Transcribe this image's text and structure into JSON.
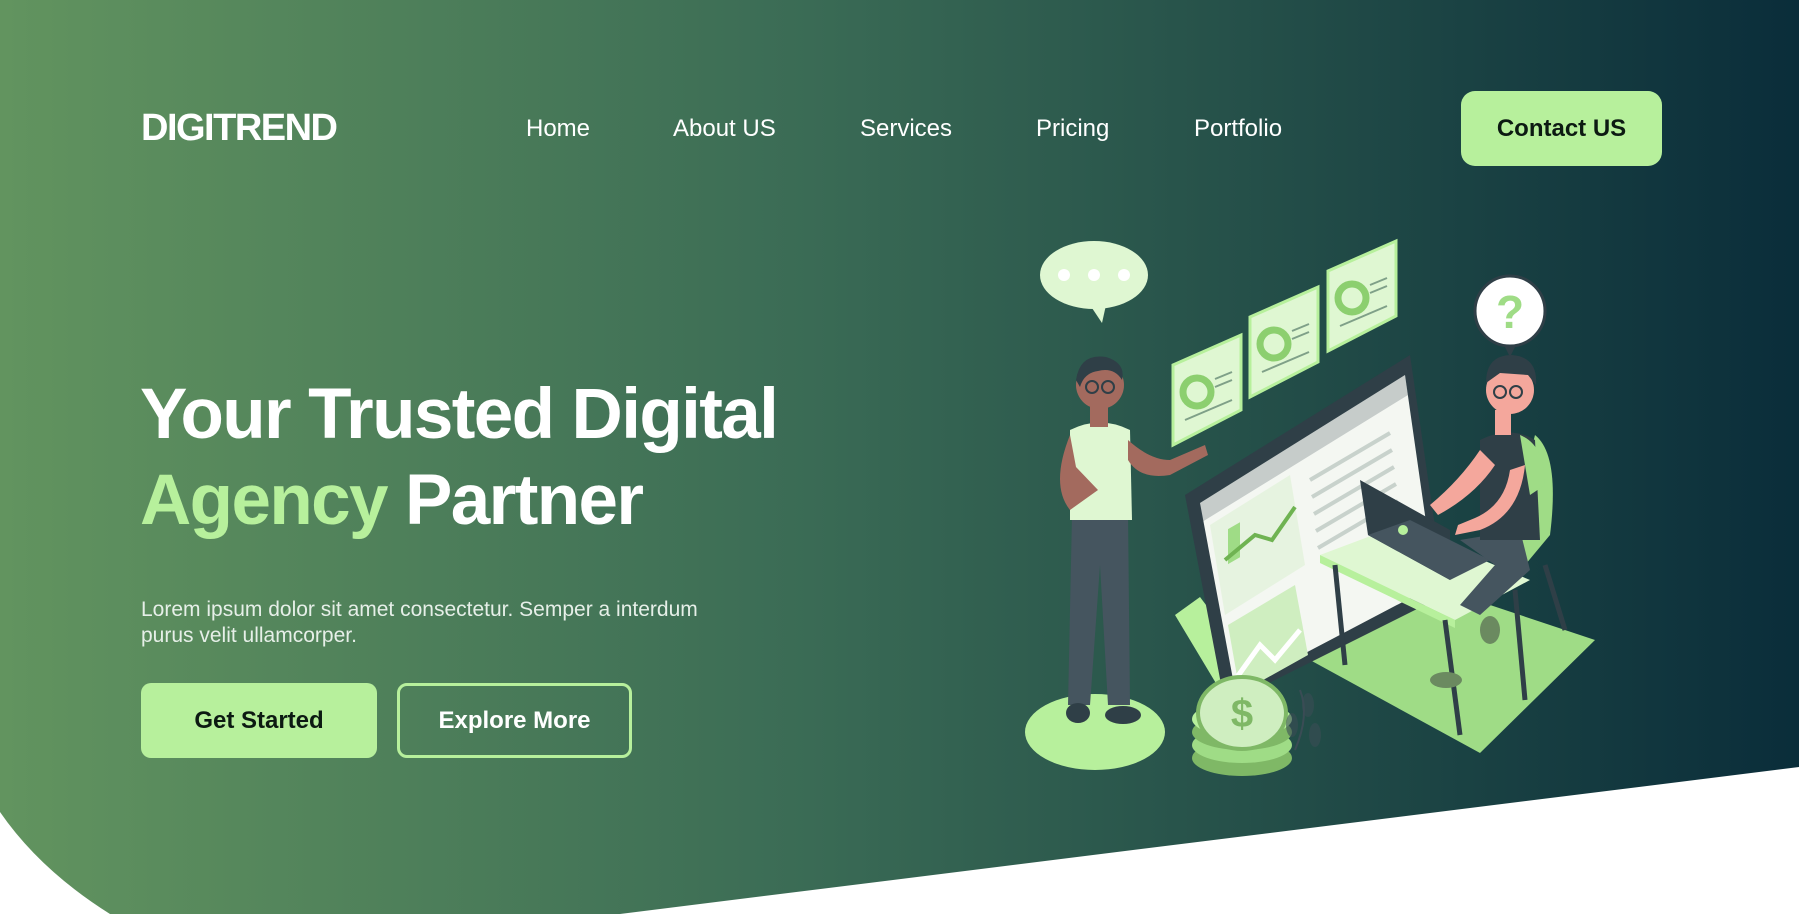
{
  "colors": {
    "gradient_start": "#62945f",
    "gradient_end": "#0a2d3a",
    "accent": "#b7f09c",
    "white": "#ffffff"
  },
  "header": {
    "logo": "DIGITREND",
    "nav": [
      {
        "label": "Home"
      },
      {
        "label": "About US"
      },
      {
        "label": "Services"
      },
      {
        "label": "Pricing"
      },
      {
        "label": "Portfolio"
      }
    ],
    "contact_label": "Contact US"
  },
  "hero": {
    "headline_line1": "Your Trusted Digital",
    "headline_accent": "Agency",
    "headline_rest": "Partner",
    "subtext": "Lorem ipsum dolor sit amet consectetur. Semper a interdum purus velit ullamcorper.",
    "primary_label": "Get Started",
    "secondary_label": "Explore More"
  },
  "illustration": {
    "speech_bubble_icon": "ellipsis-icon",
    "question_icon": "question-mark",
    "question_text": "?",
    "coin_symbol": "$"
  }
}
